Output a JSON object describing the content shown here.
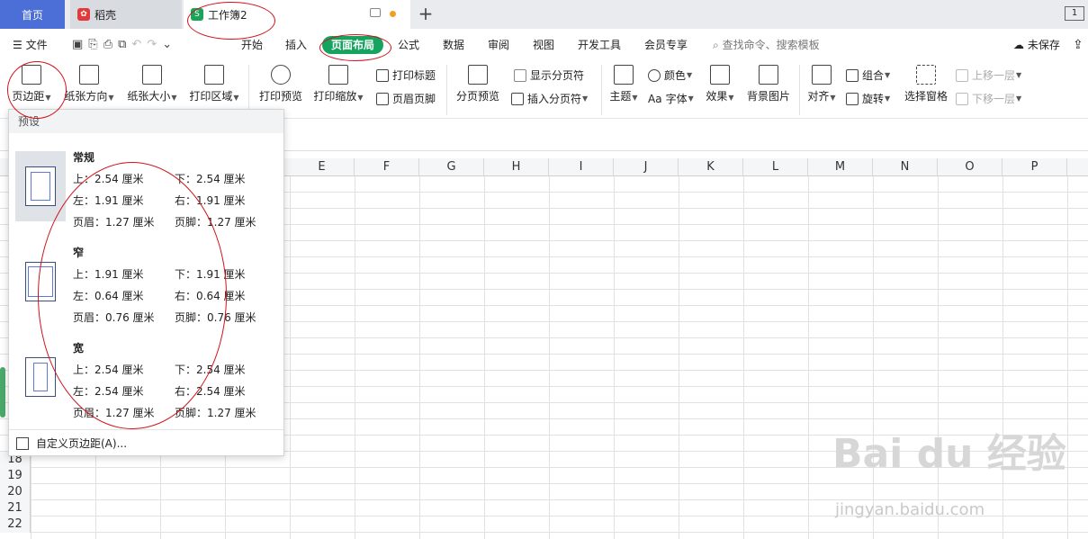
{
  "tabs": {
    "home": "首页",
    "daoke": "稻壳",
    "workbook": "工作簿2",
    "win_btn": "1"
  },
  "menu": {
    "file": "文件",
    "tabs": [
      "开始",
      "插入",
      "页面布局",
      "公式",
      "数据",
      "审阅",
      "视图",
      "开发工具",
      "会员专享"
    ],
    "search": "查找命令、搜索模板",
    "unsaved": "未保存"
  },
  "ribbon": {
    "margins": "页边距",
    "orientation": "纸张方向",
    "size": "纸张大小",
    "print_area": "打印区域",
    "print_preview": "打印预览",
    "print_scale": "打印缩放",
    "print_title": "打印标题",
    "header_footer": "页眉页脚",
    "page_preview": "分页预览",
    "show_break": "显示分页符",
    "insert_break": "插入分页符",
    "theme": "主题",
    "colors": "颜色",
    "fonts": "字体",
    "effects": "效果",
    "bg_image": "背景图片",
    "align": "对齐",
    "group": "组合",
    "rotate": "旋转",
    "select_pane": "选择窗格",
    "bring_fwd": "上移一层",
    "send_back": "下移一层"
  },
  "dropdown": {
    "header": "预设",
    "presets": [
      {
        "name": "常规",
        "top": "上：2.54 厘米",
        "bottom": "下：2.54 厘米",
        "left": "左：1.91 厘米",
        "right": "右：1.91 厘米",
        "header": "页眉：1.27 厘米",
        "footer": "页脚：1.27 厘米"
      },
      {
        "name": "窄",
        "top": "上：1.91 厘米",
        "bottom": "下：1.91 厘米",
        "left": "左：0.64 厘米",
        "right": "右：0.64 厘米",
        "header": "页眉：0.76 厘米",
        "footer": "页脚：0.76 厘米"
      },
      {
        "name": "宽",
        "top": "上：2.54 厘米",
        "bottom": "下：2.54 厘米",
        "left": "左：2.54 厘米",
        "right": "右：2.54 厘米",
        "header": "页眉：1.27 厘米",
        "footer": "页脚：1.27 厘米"
      }
    ],
    "custom": "自定义页边距(A)..."
  },
  "grid": {
    "columns": [
      "E",
      "F",
      "G",
      "H",
      "I",
      "J",
      "K",
      "L",
      "M",
      "N",
      "O",
      "P"
    ],
    "rows": [
      "18",
      "19",
      "20",
      "21",
      "22"
    ]
  },
  "watermark": {
    "brand": "Bai du 经验",
    "url": "jingyan.baidu.com"
  },
  "colors": {
    "accent_green": "#16a35f",
    "home_blue": "#4b6fd6",
    "annotation_red": "#d0141c"
  }
}
